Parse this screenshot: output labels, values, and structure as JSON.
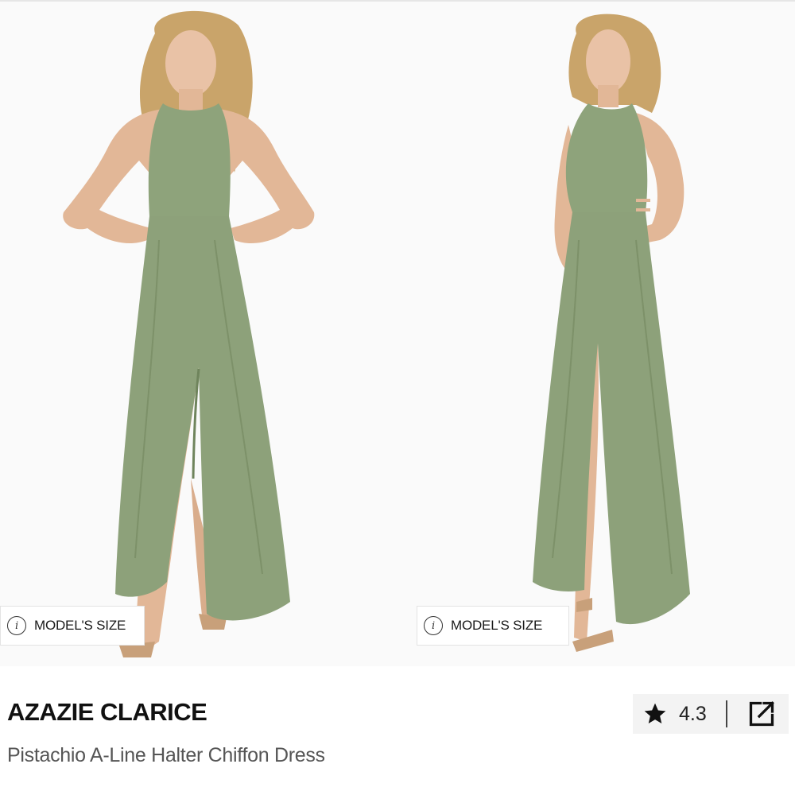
{
  "gallery": {
    "images": [
      {
        "alt": "front view",
        "model_size_label": "MODEL'S SIZE"
      },
      {
        "alt": "side view",
        "model_size_label": "MODEL'S SIZE"
      }
    ],
    "dress_color": "#8da17a",
    "info_icon": "info-icon"
  },
  "product": {
    "brand": "AZAZIE CLARICE",
    "name": "Pistachio A-Line Halter Chiffon Dress",
    "rating": "4.3",
    "rating_icon": "star-icon",
    "share_icon": "external-share-icon"
  }
}
